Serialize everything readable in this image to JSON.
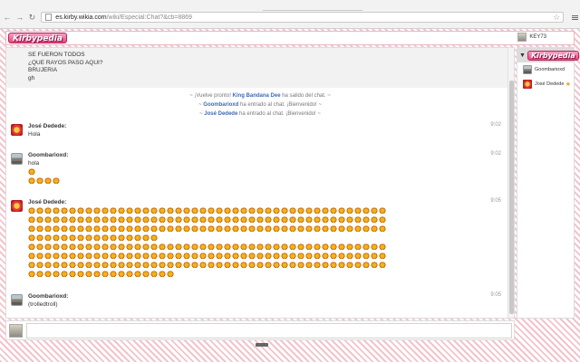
{
  "browser": {
    "url_host": "es.kirby.wikia.com",
    "url_path": "/wiki/Especial:Chat?&cb=8869"
  },
  "header": {
    "logo_text": "Kirbypedia",
    "current_user": "KEY73"
  },
  "messages_top": {
    "lines": [
      "SE FUERON TODOS",
      "¿QUE RAYOS PASO AQUI?",
      "BRUJERIA",
      "gh"
    ]
  },
  "inline_alerts": [
    {
      "prefix": "~ ¡Vuelve pronto! ",
      "name": "King Bandana Dee",
      "suffix": " ha salido del chat. ~"
    },
    {
      "prefix": "~ ",
      "name": "Goombarioxd",
      "suffix": " ha entrado al chat. ¡Bienvenido! ~"
    },
    {
      "prefix": "~ ",
      "name": "José Dedede",
      "suffix": " ha entrado al chat. ¡Bienvenido! ~"
    }
  ],
  "messages": [
    {
      "user": "José Dedede:",
      "text": "Hola",
      "time": "9:02"
    },
    {
      "user": "Goombarioxd:",
      "text": "hola",
      "time": "9:02"
    },
    {
      "user": "José Dedede:",
      "text": "",
      "time": "9:05"
    },
    {
      "user": "Goombarioxd:",
      "text": "(trolledtroll)",
      "time": "9:05"
    }
  ],
  "emoji": {
    "goomb_line1_count": 1,
    "goomb_line2_count": 4,
    "jose_rows": [
      44,
      44,
      44,
      16,
      44,
      44,
      44,
      18
    ]
  },
  "userlist": {
    "logo_text": "Kirbypedia",
    "users": [
      {
        "name": "Goombarioxd"
      },
      {
        "name": "José Dedede"
      }
    ]
  },
  "input": {
    "value": ""
  }
}
